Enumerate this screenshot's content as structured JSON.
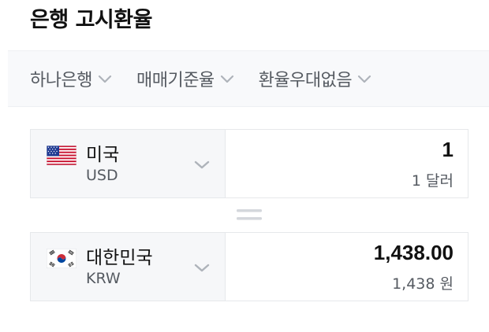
{
  "header": {
    "title": "은행 고시환율"
  },
  "filters": [
    {
      "label": "하나은행"
    },
    {
      "label": "매매기준율"
    },
    {
      "label": "환율우대없음"
    }
  ],
  "from": {
    "country": "미국",
    "code": "USD",
    "amount": "1",
    "amount_text": "1 달러",
    "flag": "us-flag"
  },
  "to": {
    "country": "대한민국",
    "code": "KRW",
    "amount": "1,438.00",
    "amount_text": "1,438 원",
    "flag": "kr-flag"
  },
  "colors": {
    "filter_bg": "#f8f9fb",
    "select_bg": "#f6f7f9",
    "border": "#e6e8eb",
    "muted_text": "#555a61"
  }
}
